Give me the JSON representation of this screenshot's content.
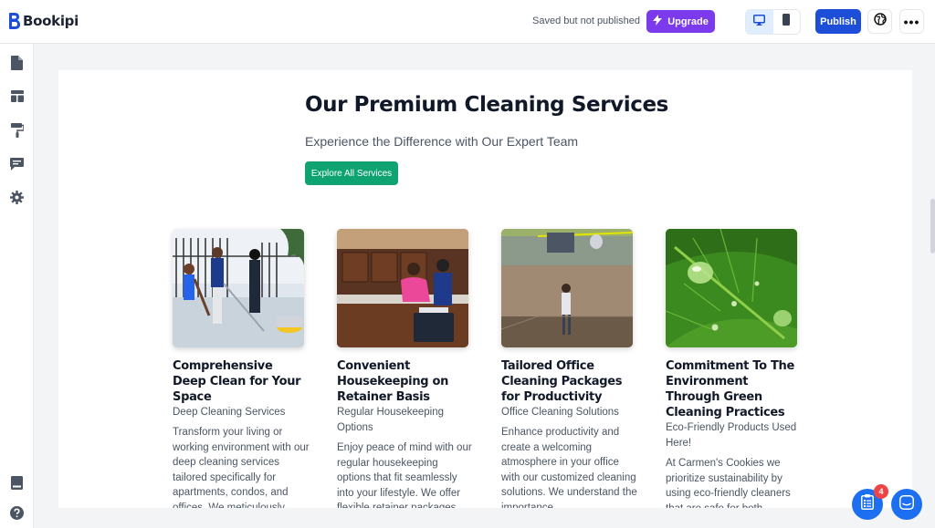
{
  "app": {
    "name": "Bookipi"
  },
  "header": {
    "status": "Saved but not published",
    "upgrade_label": "Upgrade",
    "publish_label": "Publish",
    "active_device": "desktop"
  },
  "sidebar": {
    "items": [
      {
        "icon": "page-icon"
      },
      {
        "icon": "layout-icon"
      },
      {
        "icon": "paint-roller-icon"
      },
      {
        "icon": "comment-icon"
      },
      {
        "icon": "gear-icon"
      }
    ],
    "bottom_items": [
      {
        "icon": "book-icon"
      },
      {
        "icon": "help-icon"
      }
    ]
  },
  "hero": {
    "title": "Our Premium Cleaning Services",
    "subtitle": "Experience the Difference with Our Expert Team",
    "button_label": "Explore All Services"
  },
  "services": [
    {
      "title": "Comprehensive Deep Clean for Your Space",
      "category": "Deep Cleaning Services",
      "description": "Transform your living or working environment with our deep cleaning services tailored specifically for apartments, condos, and offices. We meticulously"
    },
    {
      "title": "Convenient Housekeeping on Retainer Basis",
      "category": "Regular Housekeeping Options",
      "description": "Enjoy peace of mind with our regular housekeeping options that fit seamlessly into your lifestyle. We offer flexible retainer packages"
    },
    {
      "title": "Tailored Office Cleaning Packages for Productivity",
      "category": "Office Cleaning Solutions",
      "description": "Enhance productivity and create a welcoming atmosphere in your office with our customized cleaning solutions. We understand the importance"
    },
    {
      "title": "Commitment To The Environment Through Green Cleaning Practices",
      "category": "Eco-Friendly Products Used Here!",
      "description": "At Carmen's Cookies we prioritize sustainability by using eco-friendly cleaners that are safe for both"
    }
  ],
  "widgets": {
    "tasks_badge_count": "4"
  },
  "colors": {
    "brand_blue": "#1d4ed8",
    "upgrade_purple": "#7c3aed",
    "cta_green": "#0fa371",
    "badge_red": "#ef4444"
  }
}
